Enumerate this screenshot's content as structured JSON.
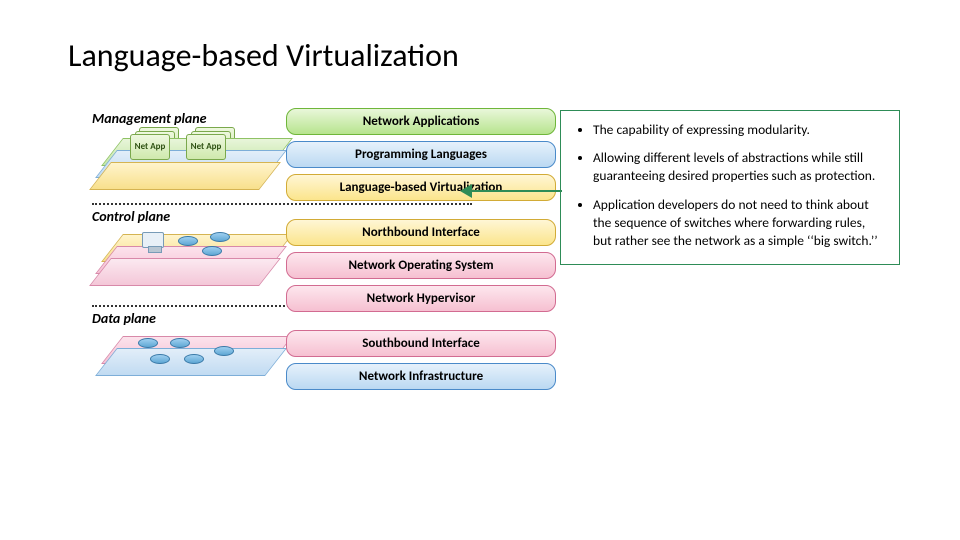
{
  "title": "Language-based Virtualization",
  "planes": {
    "management": "Management plane",
    "control": "Control plane",
    "data": "Data plane"
  },
  "net_app_label": "Net App",
  "stack": {
    "applications": "Network Applications",
    "languages": "Programming Languages",
    "lang_virt": "Language-based Virtualization",
    "northbound": "Northbound Interface",
    "nos": "Network Operating System",
    "hypervisor": "Network Hypervisor",
    "southbound": "Southbound Interface",
    "infrastructure": "Network Infrastructure"
  },
  "callout": {
    "items": [
      "The capability of expressing modularity.",
      "Allowing different levels of abstractions while still guaranteeing desired properties such as protection.",
      "Application developers do not need to think about the sequence of switches where forwarding rules, but rather see the network as a simple ‘‘big switch.’’"
    ]
  }
}
